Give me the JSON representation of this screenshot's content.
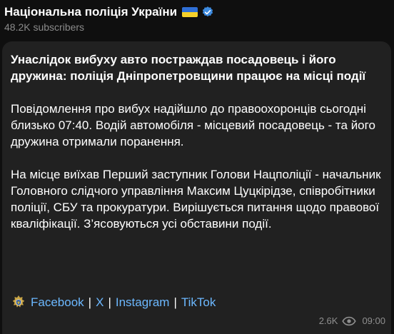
{
  "channel": {
    "title": "Національна поліція України",
    "subscribers": "48.2K subscribers"
  },
  "post": {
    "title": "Унаслідок вибуху авто постраждав посадовець і його дружина: поліція Дніпропетровщини працює на місці події",
    "paragraphs": [
      "Повідомлення про вибух надійшло до правоохоронців сьогодні близько 07:40. Водій автомобіля - місцевий посадовець - та його дружина отримали поранення.",
      "На місце виїхав Перший заступник Голови Нацполіції - начальник Головного слідчого управління Максим Цуцкірідзе, співробітники поліції, СБУ та прокуратури. Вирішується питання щодо правової кваліфікації. З’ясовуються усі обставини події."
    ],
    "links": [
      "Facebook",
      "X",
      "Instagram",
      "TikTok"
    ],
    "separator": "|",
    "views": "2.6K",
    "time": "09:00"
  },
  "icons": [
    "ukraine-flag-icon",
    "verified-icon",
    "police-badge-icon",
    "eye-icon"
  ],
  "colors": {
    "background": "#0f0f0f",
    "bubble": "#212121",
    "link": "#6cb8ff",
    "muted": "#8a8a8a"
  }
}
